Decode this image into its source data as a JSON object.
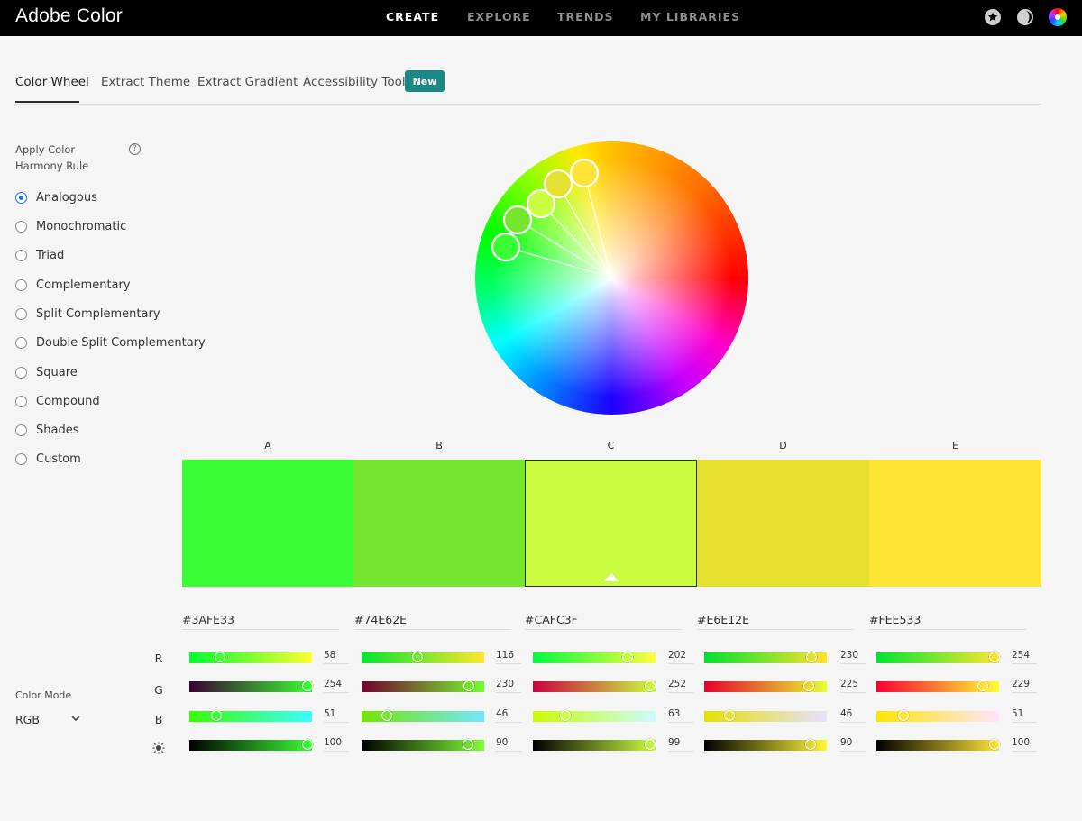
{
  "app": {
    "title": "Adobe Color"
  },
  "nav": [
    "CREATE",
    "EXPLORE",
    "TRENDS",
    "MY LIBRARIES"
  ],
  "icons": {
    "favorites": "star-icon",
    "theme": "moon-icon",
    "color": "color-wheel-icon"
  },
  "tabs": [
    "Color Wheel",
    "Extract Theme",
    "Extract Gradient",
    "Accessibility Tools"
  ],
  "badge": "New",
  "harmony": {
    "title": "Apply Color Harmony Rule",
    "help": "?",
    "selected": "Analogous",
    "rules": [
      "Analogous",
      "Monochromatic",
      "Triad",
      "Complementary",
      "Split Complementary",
      "Double Split Complementary",
      "Square",
      "Compound",
      "Shades",
      "Custom"
    ]
  },
  "color_mode": {
    "label": "Color Mode",
    "value": "RGB"
  },
  "row_labels": {
    "r": "R",
    "g": "G",
    "b": "B"
  },
  "selected_swatch": "C",
  "swatches": [
    {
      "label": "A",
      "hex": "#3AFE33",
      "color": "#3afe33",
      "r": "58",
      "g": "254",
      "b": "51",
      "brightness": "100"
    },
    {
      "label": "B",
      "hex": "#74E62E",
      "color": "#74e62e",
      "r": "116",
      "g": "230",
      "b": "46",
      "brightness": "90"
    },
    {
      "label": "C",
      "hex": "#CAFC3F",
      "color": "#cafc3f",
      "r": "202",
      "g": "252",
      "b": "63",
      "brightness": "99"
    },
    {
      "label": "D",
      "hex": "#E6E12E",
      "color": "#e6e12e",
      "r": "230",
      "g": "225",
      "b": "46",
      "brightness": "90"
    },
    {
      "label": "E",
      "hex": "#FEE533",
      "color": "#fee533",
      "r": "254",
      "g": "229",
      "b": "51",
      "brightness": "100"
    }
  ]
}
